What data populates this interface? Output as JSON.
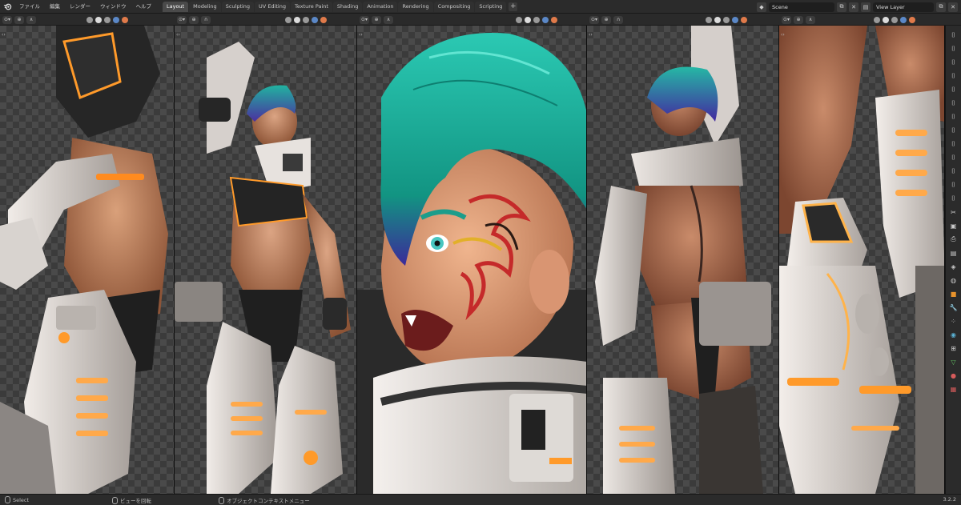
{
  "app": {
    "menus": [
      "ファイル",
      "編集",
      "レンダー",
      "ウィンドウ",
      "ヘルプ"
    ],
    "workspaces": [
      "Layout",
      "Modeling",
      "Sculpting",
      "UV Editing",
      "Texture Paint",
      "Shading",
      "Animation",
      "Rendering",
      "Compositing",
      "Scripting"
    ],
    "active_workspace": "Layout",
    "add_tab": "+",
    "scene": "Scene",
    "view_layer": "View Layer"
  },
  "statusbar": {
    "select": "Select",
    "rotate_view": "ビューを回転",
    "context_menu": "オブジェクトコンテキストメニュー",
    "version": "3.2.2"
  },
  "viewports": [
    {
      "label": "viewport-1",
      "subject": "side view: torso & armored leg"
    },
    {
      "label": "viewport-2",
      "subject": "full body raised arm pose"
    },
    {
      "label": "viewport-3",
      "subject": "face close-up teal hair"
    },
    {
      "label": "viewport-4",
      "subject": "back view"
    },
    {
      "label": "viewport-5",
      "subject": "leg armor close-up"
    }
  ],
  "colors": {
    "ui_bg": "#2b2b2b",
    "active_tab": "#4a4a4a",
    "hair_teal": "#1fae9a",
    "glow_orange": "#ff9a2a",
    "armor_white": "#d9d3d0",
    "skin": "#c98b6a"
  },
  "icons": {
    "right_toolbar": [
      "camera-icon",
      "camera-icon",
      "camera-icon",
      "camera-icon",
      "camera-icon",
      "camera-icon",
      "camera-icon",
      "camera-icon",
      "camera-icon",
      "camera-icon",
      "camera-icon",
      "camera-icon",
      "camera-icon",
      "tool-icon",
      "render-icon",
      "output-icon",
      "view-layer-icon",
      "scene-icon",
      "world-icon",
      "object-icon",
      "modifier-icon",
      "particles-icon",
      "physics-icon",
      "constraints-icon",
      "data-icon",
      "material-icon",
      "texture-icon"
    ]
  }
}
